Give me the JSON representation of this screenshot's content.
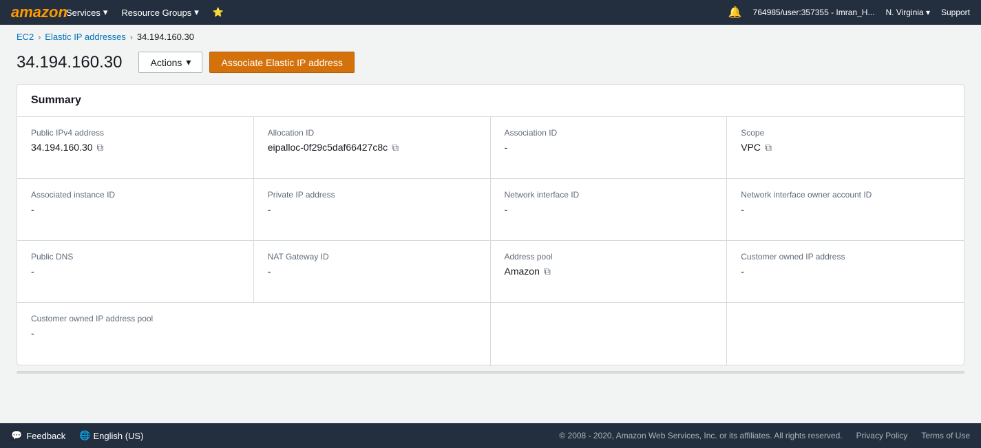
{
  "nav": {
    "logo": "amazon",
    "items": [
      {
        "label": "Services",
        "id": "services"
      },
      {
        "label": "Resource Groups",
        "id": "resource-groups"
      },
      {
        "label": "★",
        "id": "favorites"
      }
    ],
    "right": [
      {
        "label": "🔔",
        "id": "bell-icon"
      },
      {
        "label": "764985/user:357355 - Imran_H...",
        "id": "user-menu"
      },
      {
        "label": "N. Virginia",
        "id": "region-menu"
      },
      {
        "label": "Support",
        "id": "support-menu"
      }
    ]
  },
  "breadcrumb": {
    "items": [
      {
        "label": "EC2",
        "link": true
      },
      {
        "label": "Elastic IP addresses",
        "link": true
      },
      {
        "label": "34.194.160.30",
        "link": false
      }
    ]
  },
  "header": {
    "title": "34.194.160.30",
    "actions_label": "Actions",
    "associate_label": "Associate Elastic IP address"
  },
  "summary": {
    "title": "Summary",
    "cells": [
      {
        "label": "Public IPv4 address",
        "value": "34.194.160.30",
        "copyable": true,
        "id": "public-ipv4"
      },
      {
        "label": "Allocation ID",
        "value": "eipalloc-0f29c5daf66427c8c",
        "copyable": true,
        "id": "allocation-id"
      },
      {
        "label": "Association ID",
        "value": "-",
        "copyable": false,
        "id": "association-id"
      },
      {
        "label": "Scope",
        "value": "VPC",
        "copyable": true,
        "id": "scope"
      },
      {
        "label": "Associated instance ID",
        "value": "-",
        "copyable": false,
        "id": "associated-instance-id"
      },
      {
        "label": "Private IP address",
        "value": "-",
        "copyable": false,
        "id": "private-ip"
      },
      {
        "label": "Network interface ID",
        "value": "-",
        "copyable": false,
        "id": "network-interface-id"
      },
      {
        "label": "Network interface owner account ID",
        "value": "-",
        "copyable": false,
        "id": "network-interface-owner"
      },
      {
        "label": "Public DNS",
        "value": "-",
        "copyable": false,
        "id": "public-dns"
      },
      {
        "label": "NAT Gateway ID",
        "value": "-",
        "copyable": false,
        "id": "nat-gateway-id"
      },
      {
        "label": "Address pool",
        "value": "Amazon",
        "copyable": true,
        "id": "address-pool"
      },
      {
        "label": "Customer owned IP address",
        "value": "-",
        "copyable": false,
        "id": "customer-owned-ip"
      },
      {
        "label": "Customer owned IP address pool",
        "value": "-",
        "copyable": false,
        "id": "customer-owned-ip-pool"
      }
    ]
  },
  "footer": {
    "feedback_label": "Feedback",
    "language_label": "English (US)",
    "copyright": "© 2008 - 2020, Amazon Web Services, Inc. or its affiliates. All rights reserved.",
    "privacy_policy": "Privacy Policy",
    "terms_of_use": "Terms of Use"
  },
  "icons": {
    "copy": "⧉",
    "chevron_down": "▾",
    "chat_bubble": "💬",
    "globe": "🌐",
    "bell": "🔔"
  }
}
